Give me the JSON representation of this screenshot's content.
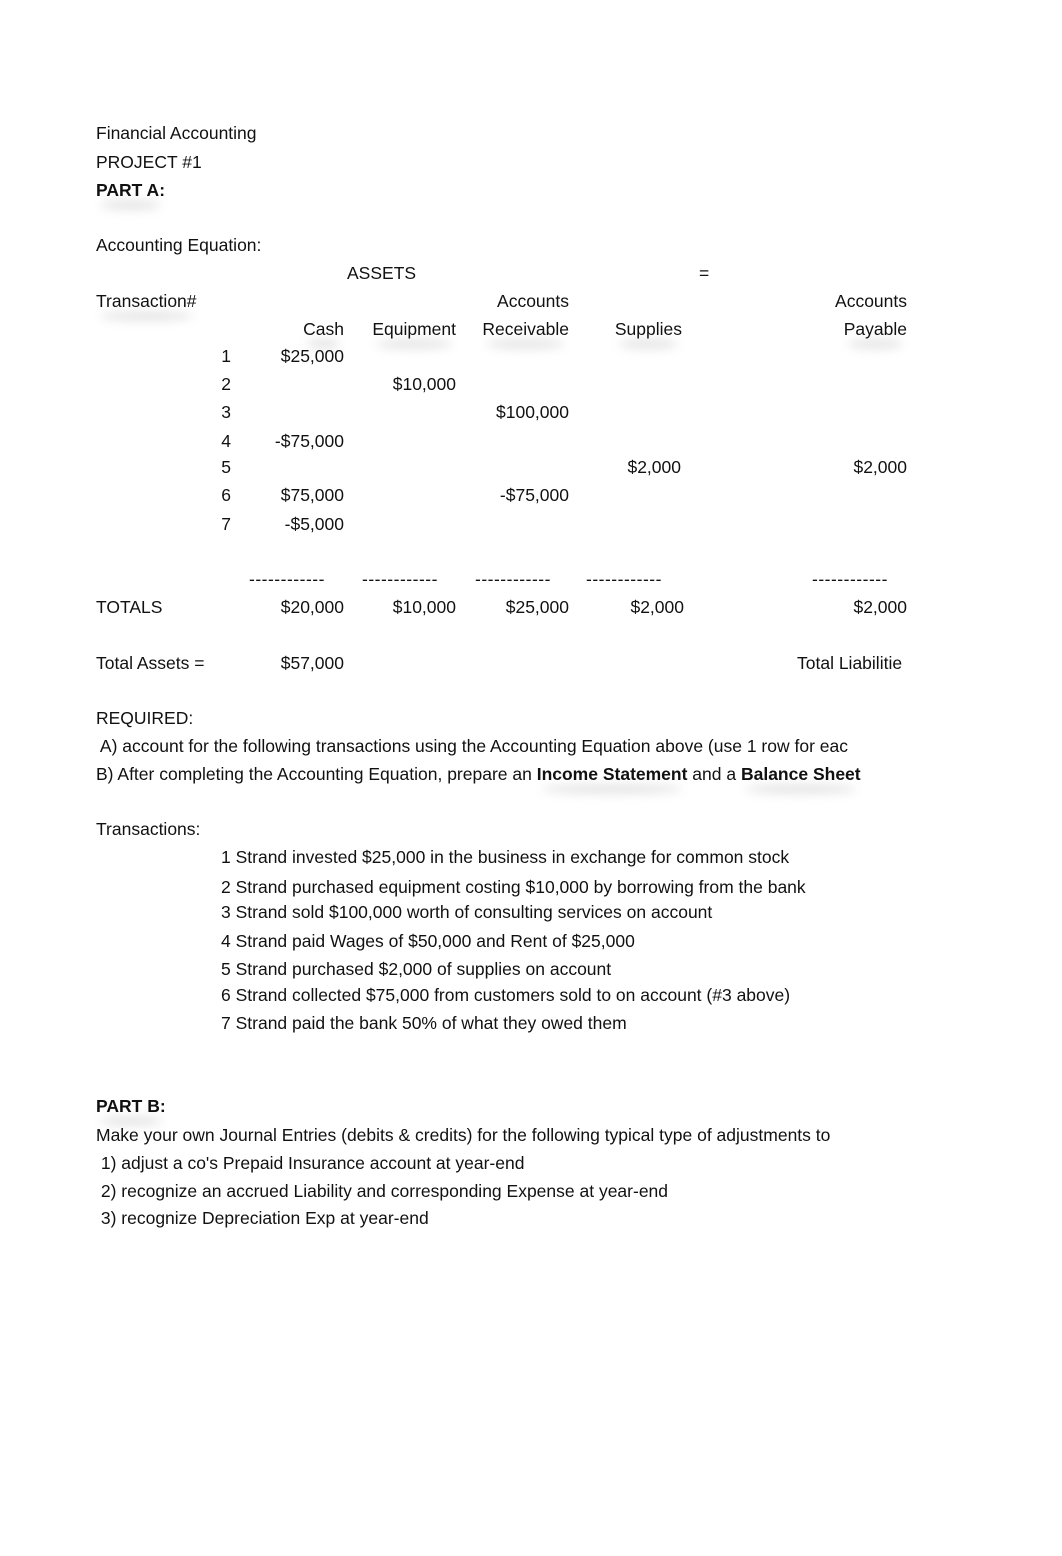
{
  "header": {
    "course": "Financial Accounting",
    "project": "PROJECT #1",
    "part_a": "PART A:"
  },
  "equation": {
    "title": "Accounting Equation:",
    "assets_label": "ASSETS",
    "equals": "=",
    "transaction_label": "Transaction#",
    "columns": [
      {
        "line1": "",
        "line2": "Cash"
      },
      {
        "line1": "",
        "line2": "Equipment"
      },
      {
        "line1": "Accounts",
        "line2": "Receivable"
      },
      {
        "line1": "",
        "line2": "Supplies"
      },
      {
        "line1": "Accounts",
        "line2": "Payable"
      }
    ],
    "rows": [
      {
        "num": "1",
        "cash": "$25,000",
        "equipment": "",
        "receivable": "",
        "supplies": "",
        "payable": ""
      },
      {
        "num": "2",
        "cash": "",
        "equipment": "$10,000",
        "receivable": "",
        "supplies": "",
        "payable": ""
      },
      {
        "num": "3",
        "cash": "",
        "equipment": "",
        "receivable": "$100,000",
        "supplies": "",
        "payable": ""
      },
      {
        "num": "4",
        "cash": "-$75,000",
        "equipment": "",
        "receivable": "",
        "supplies": "",
        "payable": ""
      },
      {
        "num": "5",
        "cash": "",
        "equipment": "",
        "receivable": "",
        "supplies": "$2,000",
        "payable": "$2,000"
      },
      {
        "num": "6",
        "cash": "$75,000",
        "equipment": "",
        "receivable": "-$75,000",
        "supplies": "",
        "payable": ""
      },
      {
        "num": "7",
        "cash": "-$5,000",
        "equipment": "",
        "receivable": "",
        "supplies": "",
        "payable": ""
      }
    ],
    "separator": "------------",
    "totals_label": "TOTALS",
    "totals": {
      "cash": "$20,000",
      "equipment": "$10,000",
      "receivable": "$25,000",
      "supplies": "$2,000",
      "payable": "$2,000"
    },
    "total_assets_label": "Total Assets =",
    "total_assets_value": "$57,000",
    "total_liabilities_label": "Total Liabilitie"
  },
  "required": {
    "title": "REQUIRED:",
    "a": " A) account for the following transactions using the Accounting Equation above (use 1 row for eac",
    "b_prefix": "B) After completing the Accounting Equation, prepare an ",
    "b_bold1": "Income Statement",
    "b_mid": " and a ",
    "b_bold2": "Balance Sheet"
  },
  "transactions": {
    "title": "Transactions:",
    "items": [
      "1 Strand invested $25,000 in the business in exchange for common stock",
      "2 Strand purchased equipment costing $10,000 by borrowing from the bank",
      "3 Strand sold $100,000 worth of consulting services on account",
      "4 Strand paid Wages of $50,000 and Rent of $25,000",
      "5 Strand purchased $2,000 of supplies on account",
      "6 Strand collected $75,000 from customers sold to on account (#3 above)",
      "7 Strand paid the bank 50% of what they owed them"
    ]
  },
  "part_b": {
    "title": "PART B:",
    "intro": "Make your own Journal Entries (debits & credits) for the following typical type of adjustments to",
    "items": [
      " 1) adjust a co's Prepaid Insurance account at year-end",
      " 2) recognize an accrued Liability and corresponding Expense at year-end",
      " 3) recognize Depreciation Exp at year-end"
    ]
  }
}
